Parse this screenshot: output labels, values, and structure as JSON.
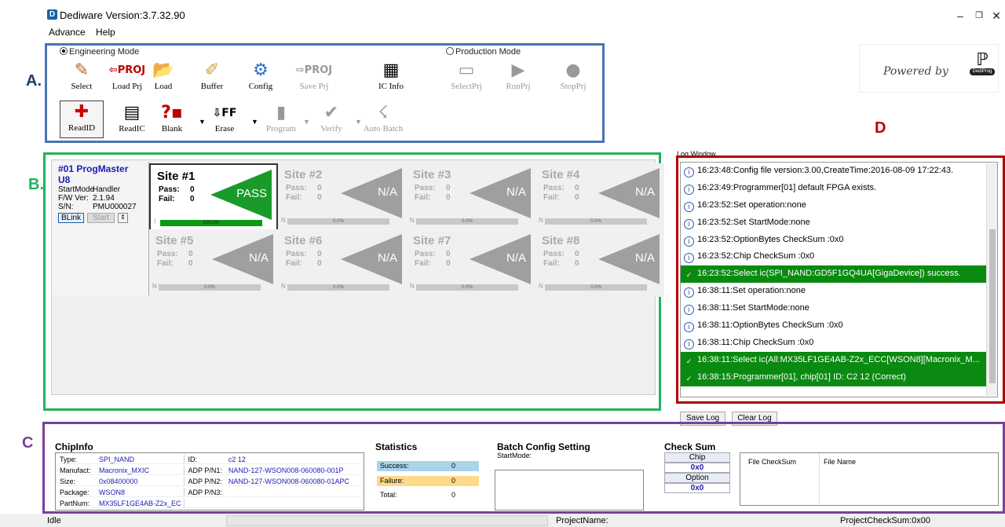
{
  "app": {
    "title": "Dediware Version:3.7.32.90"
  },
  "menu": [
    "Advance",
    "Help"
  ],
  "callouts": {
    "a": "A.",
    "b": "B.",
    "c": "C",
    "d": "D"
  },
  "engineering": {
    "label": "Engineering Mode",
    "row1": [
      "Select",
      "Load Prj",
      "Load",
      "Buffer",
      "Config",
      "Save Prj",
      "IC Info"
    ],
    "row2": [
      "ReadID",
      "ReadIC",
      "Blank",
      "Erase",
      "Program",
      "Verify",
      "Auto Batch"
    ]
  },
  "production": {
    "label": "Production Mode",
    "tools": [
      "SelectPrj",
      "RunPrj",
      "StopPrj"
    ]
  },
  "powered": {
    "text": "Powered by",
    "badge": "DediProg"
  },
  "programmer": {
    "name": "#01 ProgMaster U8",
    "startmode_label": "StartMode",
    "startmode": "Handler",
    "fw_label": "F/W Ver:",
    "fw": "2.1.94",
    "sn_label": "S/N:",
    "sn": "PMU000027",
    "blink": "BLink",
    "start": "Start"
  },
  "sites": [
    {
      "title": "Site #1",
      "pass": "0",
      "fail": "0",
      "result": "PASS",
      "bar": "100.0%",
      "bar_prefix": "I",
      "progress": 1.0,
      "active": true
    },
    {
      "title": "Site #2",
      "pass": "0",
      "fail": "0",
      "result": "N/A",
      "bar": "0.0%",
      "bar_prefix": "N",
      "progress": 0,
      "active": false
    },
    {
      "title": "Site #3",
      "pass": "0",
      "fail": "0",
      "result": "N/A",
      "bar": "0.0%",
      "bar_prefix": "N",
      "progress": 0,
      "active": false
    },
    {
      "title": "Site #4",
      "pass": "0",
      "fail": "0",
      "result": "N/A",
      "bar": "0.0%",
      "bar_prefix": "N",
      "progress": 0,
      "active": false
    },
    {
      "title": "Site #5",
      "pass": "0",
      "fail": "0",
      "result": "N/A",
      "bar": "0.0%",
      "bar_prefix": "N",
      "progress": 0,
      "active": false
    },
    {
      "title": "Site #6",
      "pass": "0",
      "fail": "0",
      "result": "N/A",
      "bar": "0.0%",
      "bar_prefix": "N",
      "progress": 0,
      "active": false
    },
    {
      "title": "Site #7",
      "pass": "0",
      "fail": "0",
      "result": "N/A",
      "bar": "0.0%",
      "bar_prefix": "N",
      "progress": 0,
      "active": false
    },
    {
      "title": "Site #8",
      "pass": "0",
      "fail": "0",
      "result": "N/A",
      "bar": "0.0%",
      "bar_prefix": "N",
      "progress": 0,
      "active": false
    }
  ],
  "site_labels": {
    "pass": "Pass:",
    "fail": "Fail:"
  },
  "log": {
    "title": "Log Window",
    "lines": [
      {
        "text": "16:23:48:Config file version:3.00,CreateTime:2016-08-09 17:22:43.",
        "ok": false
      },
      {
        "text": "16:23:49:Programmer[01] default FPGA exists.",
        "ok": false
      },
      {
        "text": "16:23:52:Set operation:none",
        "ok": false
      },
      {
        "text": "16:23:52:Set StartMode:none",
        "ok": false
      },
      {
        "text": "16:23:52:OptionBytes CheckSum :0x0",
        "ok": false
      },
      {
        "text": "16:23:52:Chip CheckSum :0x0",
        "ok": false
      },
      {
        "text": "16:23:52:Select ic(SPI_NAND:GD5F1GQ4UA[GigaDevice]) success.",
        "ok": true
      },
      {
        "text": "16:38:11:Set operation:none",
        "ok": false
      },
      {
        "text": "16:38:11:Set StartMode:none",
        "ok": false
      },
      {
        "text": "16:38:11:OptionBytes CheckSum :0x0",
        "ok": false
      },
      {
        "text": "16:38:11:Chip CheckSum :0x0",
        "ok": false
      },
      {
        "text": "16:38:11:Select ic(All:MX35LF1GE4AB-Z2x_ECC[WSON8][Macronix_M...",
        "ok": true
      },
      {
        "text": "16:38:15:Programmer[01], chip[01] ID: C2 12 (Correct)",
        "ok": true
      }
    ],
    "save": "Save Log",
    "clear": "Clear Log"
  },
  "chipinfo": {
    "title": "ChipInfo",
    "rows": [
      {
        "k1": "Type:",
        "v1": "SPI_NAND",
        "k2": "ID:",
        "v2": "c2 12"
      },
      {
        "k1": "Manufact:",
        "v1": "Macronix_MXIC",
        "k2": "ADP P/N1:",
        "v2": "NAND-127-WSON008-060080-001P"
      },
      {
        "k1": "Size:",
        "v1": "0x08400000",
        "k2": "ADP P/N2:",
        "v2": "NAND-127-WSON008-060080-01APC"
      },
      {
        "k1": "Package:",
        "v1": "WSON8",
        "k2": "ADP P/N3:",
        "v2": ""
      },
      {
        "k1": "PartNum:",
        "v1": "MX35LF1GE4AB-Z2x_EC",
        "k2": "",
        "v2": ""
      }
    ]
  },
  "statistics": {
    "title": "Statistics",
    "success_label": "Success:",
    "success": "0",
    "failure_label": "Failure:",
    "failure": "0",
    "total_label": "Total:",
    "total": "0"
  },
  "batch": {
    "title": "Batch Config Setting",
    "startmode": "StartMode:"
  },
  "checksum": {
    "title": "Check Sum",
    "chip_label": "Chip",
    "chip": "0x0",
    "option_label": "Option",
    "option": "0x0",
    "col_file_checksum": "File CheckSum",
    "col_file_name": "File Name"
  },
  "statusbar": {
    "state": "Idle",
    "project": "ProjectName:",
    "project_checksum": "ProjectCheckSum:0x00"
  }
}
